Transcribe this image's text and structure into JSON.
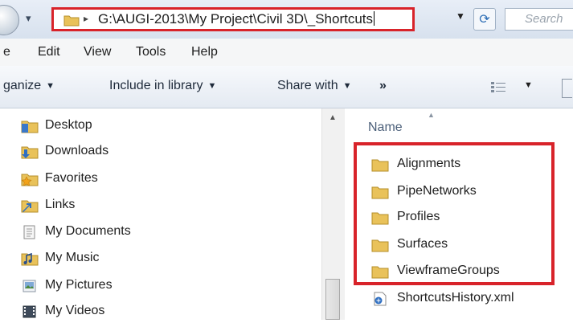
{
  "address": {
    "path": "G:\\AUGI-2013\\My Project\\Civil 3D\\_Shortcuts"
  },
  "search": {
    "placeholder": "Search"
  },
  "menu": [
    "e",
    "Edit",
    "View",
    "Tools",
    "Help"
  ],
  "toolbar": {
    "organize": "ganize",
    "include_library": "Include in library",
    "share_with": "Share with",
    "more": "»"
  },
  "nav": [
    {
      "label": "Desktop",
      "icon": "desktop-icon"
    },
    {
      "label": "Downloads",
      "icon": "downloads-icon"
    },
    {
      "label": "Favorites",
      "icon": "favorites-icon"
    },
    {
      "label": "Links",
      "icon": "links-icon"
    },
    {
      "label": "My Documents",
      "icon": "documents-icon"
    },
    {
      "label": "My Music",
      "icon": "music-icon"
    },
    {
      "label": "My Pictures",
      "icon": "pictures-icon"
    },
    {
      "label": "My Videos",
      "icon": "videos-icon"
    }
  ],
  "list": {
    "column_name": "Name",
    "folders": [
      "Alignments",
      "PipeNetworks",
      "Profiles",
      "Surfaces",
      "ViewframeGroups"
    ],
    "files": [
      "ShortcutsHistory.xml"
    ]
  },
  "colors": {
    "highlight": "#d8232a",
    "folder": "#e9c25a"
  }
}
